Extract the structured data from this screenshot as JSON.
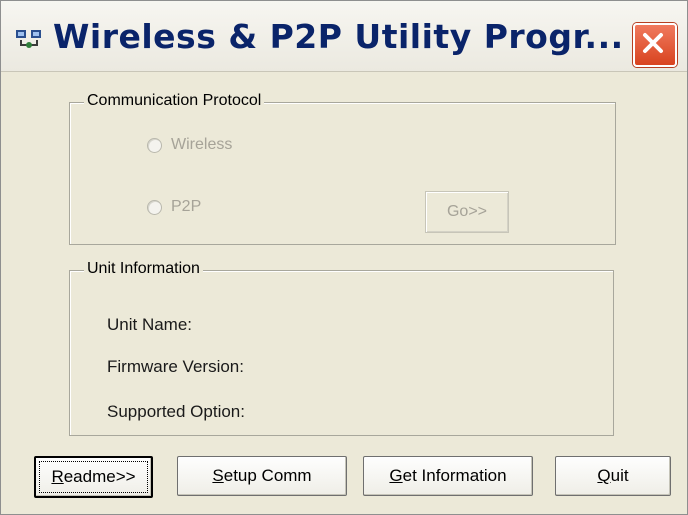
{
  "window": {
    "title": "Wireless & P2P Utility Progr...",
    "icon": "app-utility-icon",
    "close_icon": "close-icon"
  },
  "protocol_group": {
    "legend": "Communication Protocol",
    "options": [
      {
        "label": "Wireless",
        "selected": false,
        "enabled": false
      },
      {
        "label": "P2P",
        "selected": false,
        "enabled": false
      }
    ],
    "go_label": "Go>>",
    "go_enabled": false
  },
  "unit_group": {
    "legend": "Unit Information",
    "fields": [
      {
        "label": "Unit Name:"
      },
      {
        "label": "Firmware Version:"
      },
      {
        "label": "Supported Option:"
      }
    ]
  },
  "buttons": {
    "readme": {
      "mnemonic": "R",
      "rest": "eadme>>"
    },
    "setup_comm": {
      "mnemonic": "S",
      "rest": "etup Comm"
    },
    "get_information": {
      "mnemonic": "G",
      "rest": "et Information"
    },
    "quit": {
      "mnemonic": "Q",
      "rest": "uit"
    }
  },
  "colors": {
    "dialog_bg": "#ece9d8",
    "title_text": "#0a246a",
    "disabled_text": "#a6a398",
    "close_red": "#d8431f"
  }
}
